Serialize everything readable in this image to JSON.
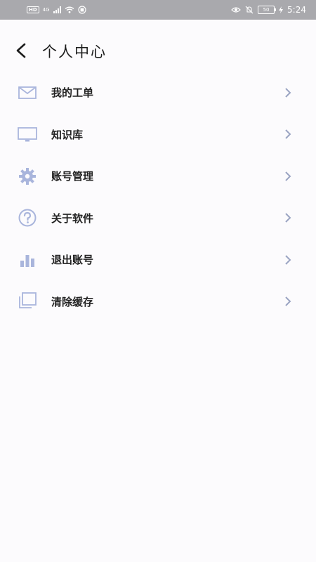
{
  "status_bar": {
    "left_items": [
      "HD",
      "4G",
      "wifi-icon",
      "nfc-icon"
    ],
    "hd_label": "HD",
    "network_label": "4G",
    "battery": "50",
    "time": "5:24",
    "icons": [
      "eye-comfort-icon",
      "mute-icon",
      "battery-icon",
      "charging-icon"
    ]
  },
  "header": {
    "title": "个人中心",
    "back_icon": "chevron-left-icon"
  },
  "menu": {
    "items": [
      {
        "label": "我的工单",
        "icon": "mail-icon"
      },
      {
        "label": "知识库",
        "icon": "monitor-icon"
      },
      {
        "label": "账号管理",
        "icon": "gear-icon"
      },
      {
        "label": "关于软件",
        "icon": "question-circle-icon"
      },
      {
        "label": "退出账号",
        "icon": "bar-chart-icon"
      },
      {
        "label": "清除缓存",
        "icon": "stacked-squares-icon"
      }
    ],
    "chevron_icon": "chevron-right-icon"
  },
  "colors": {
    "background": "#fcfbfd",
    "status_bar": "#a9a9ad",
    "icon_accent": "#a9b5dc",
    "chevron": "#9aa4c2",
    "text": "#222222"
  }
}
